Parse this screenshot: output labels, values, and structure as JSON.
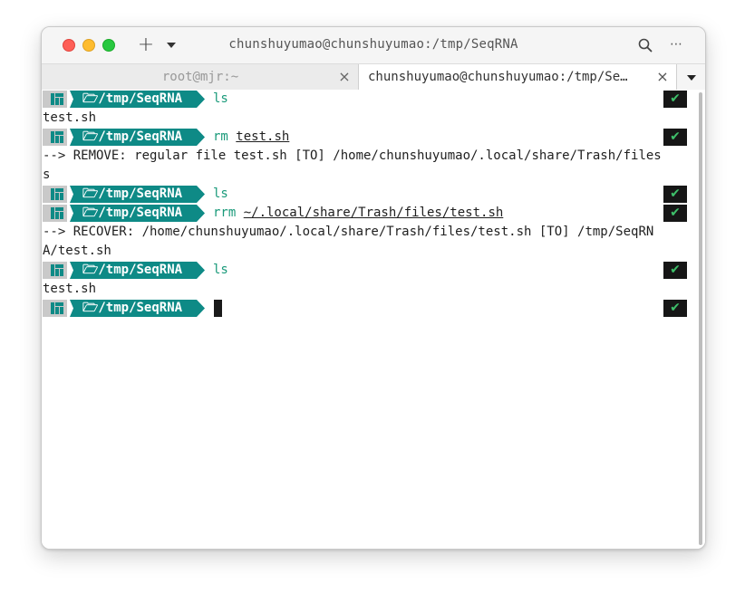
{
  "window": {
    "title": "chunshuyumao@chunshuyumao:/tmp/SeqRNA"
  },
  "toolbar": {
    "new_tab_label": "+",
    "more_label": "⋯"
  },
  "tabs": [
    {
      "label": "root@mjr:~",
      "active": false,
      "close_label": "×"
    },
    {
      "label": "chunshuyumao@chunshuyumao:/tmp/Se…",
      "active": true,
      "close_label": "×"
    }
  ],
  "prompt": {
    "dir_label": "🗁/tmp/SeqRNA",
    "status_label": "✔"
  },
  "terminal": {
    "entries": [
      {
        "type": "prompt",
        "cmd": "ls",
        "arg": ""
      },
      {
        "type": "output",
        "text": "test.sh"
      },
      {
        "type": "prompt",
        "cmd": "rm ",
        "arg": "test.sh"
      },
      {
        "type": "output",
        "text": "--> REMOVE: regular file test.sh [TO] /home/chunshuyumao/.local/share/Trash/files"
      },
      {
        "type": "output",
        "text": "s"
      },
      {
        "type": "prompt",
        "cmd": "ls",
        "arg": ""
      },
      {
        "type": "prompt",
        "cmd": "rrm ",
        "arg": "~/.local/share/Trash/files/test.sh"
      },
      {
        "type": "output",
        "text": "--> RECOVER: /home/chunshuyumao/.local/share/Trash/files/test.sh [TO] /tmp/SeqRN"
      },
      {
        "type": "output",
        "text": "A/test.sh"
      },
      {
        "type": "prompt",
        "cmd": "ls",
        "arg": ""
      },
      {
        "type": "output",
        "text": "test.sh"
      },
      {
        "type": "prompt",
        "cmd": "",
        "arg": "",
        "cursor": true
      }
    ]
  },
  "colors": {
    "prompt_teal": "#0e8a86",
    "command_green": "#1a9a7a",
    "status_check": "#3ec06a",
    "status_bg": "#161616",
    "os_segment": "#c9c9c9"
  }
}
